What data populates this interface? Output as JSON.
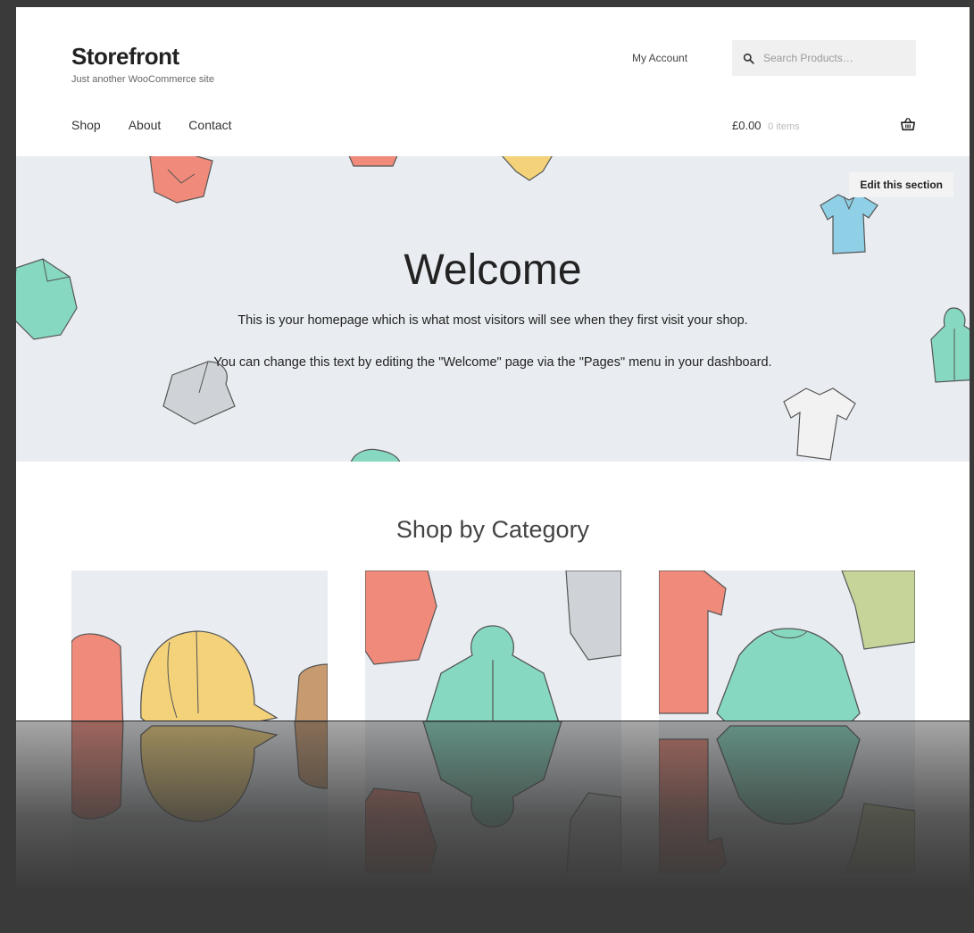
{
  "header": {
    "site_title": "Storefront",
    "tagline": "Just another WooCommerce site",
    "account_link": "My Account",
    "search_placeholder": "Search Products…",
    "nav": [
      "Shop",
      "About",
      "Contact"
    ],
    "cart_total": "£0.00",
    "cart_count": "0 items"
  },
  "hero": {
    "edit_label": "Edit this section",
    "title": "Welcome",
    "paragraph1": "This is your homepage which is what most visitors will see when they first visit your shop.",
    "paragraph2": "You can change this text by editing the \"Welcome\" page via the \"Pages\" menu in your dashboard."
  },
  "categories": {
    "heading": "Shop by Category"
  },
  "colors": {
    "coral": "#f08a7a",
    "mint": "#86d9c0",
    "yellow": "#f3d27a",
    "blue": "#8fd0e6",
    "grey": "#cfd2d6",
    "olive": "#c6d49a"
  }
}
